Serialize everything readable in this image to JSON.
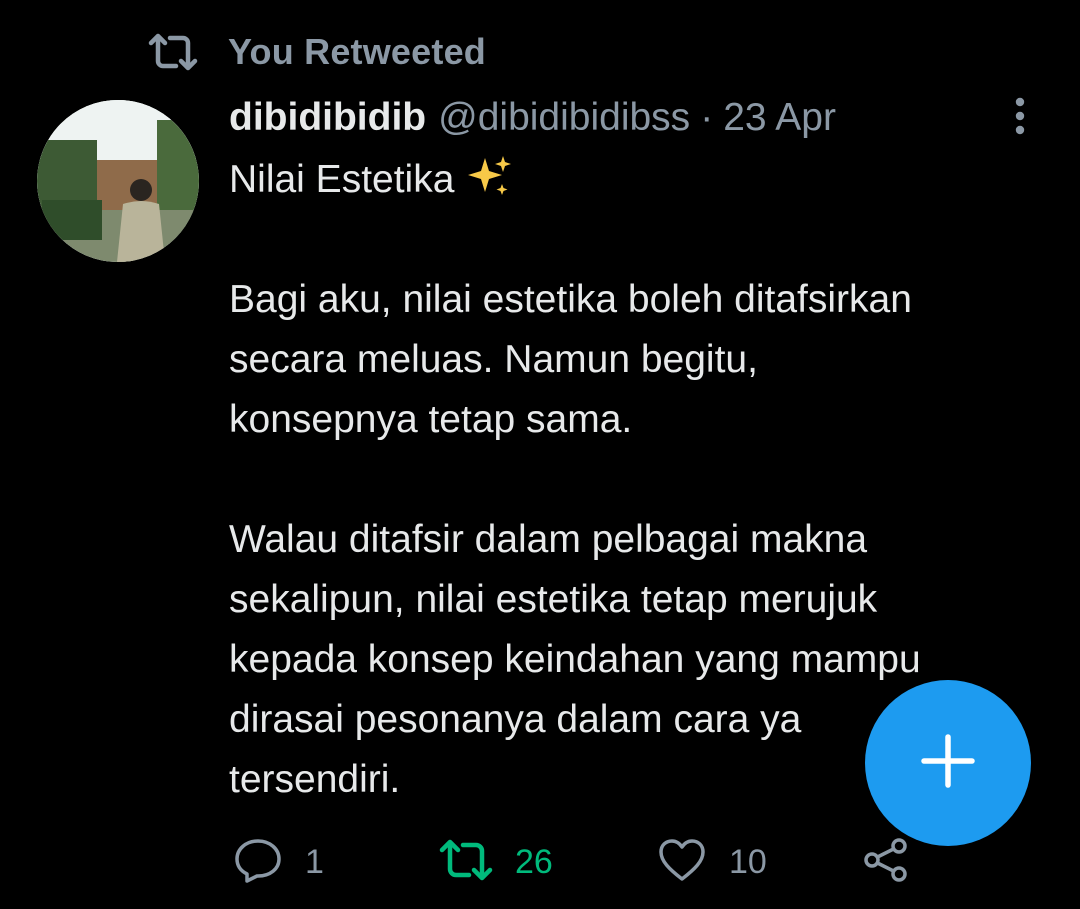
{
  "retweet_context": {
    "label": "You Retweeted",
    "icon": "retweet-icon"
  },
  "tweet": {
    "display_name": "dibidibidib",
    "handle": "@dibidibidibss",
    "separator": "·",
    "date": "23 Apr",
    "more_icon": "more-vertical-icon",
    "lines": [
      "Nilai Estetika",
      "",
      "Bagi aku, nilai estetika boleh ditafsirkan",
      "secara meluas. Namun begitu,",
      "konsepnya tetap sama.",
      "",
      "Walau ditafsir dalam pelbagai makna",
      "sekalipun, nilai estetika tetap merujuk",
      "kepada konsep keindahan yang mampu",
      "dirasai pesonanya dalam cara ya",
      "tersendiri."
    ],
    "emoji_icon": "sparkles-icon"
  },
  "actions": {
    "reply_count": "1",
    "retweet_count": "26",
    "like_count": "10"
  },
  "fab": {
    "icon": "plus-icon"
  },
  "colors": {
    "background": "#000000",
    "primary_text": "#e7e9ea",
    "secondary_text": "#8b98a5",
    "retweet_active": "#00ba7c",
    "accent": "#1d9bf0"
  }
}
